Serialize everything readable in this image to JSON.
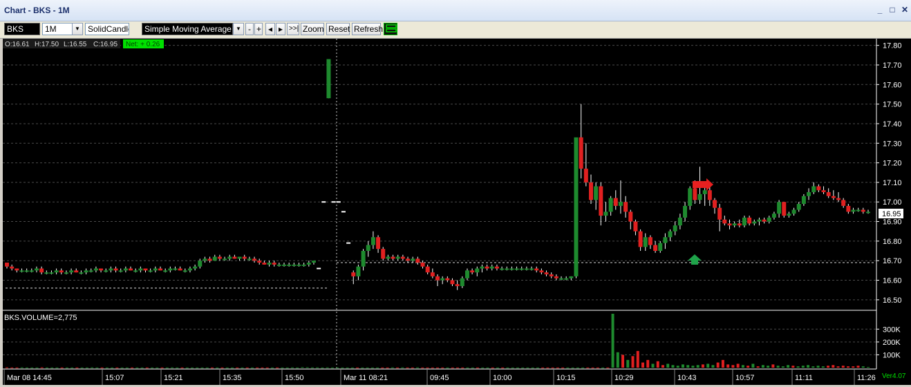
{
  "window": {
    "title": "Chart - BKS - 1M",
    "minimize": "_",
    "restore": "□",
    "close": "✕"
  },
  "toolbar": {
    "symbol": "BKS",
    "interval": "1M",
    "chart_style": "SolidCandle",
    "indicator": "Simple Moving Average",
    "minus": "-",
    "plus": "+",
    "prev": "◂",
    "next": "▸",
    "end": ">>|",
    "zoom": "Zoom",
    "reset": "Reset",
    "refresh": "Refresh"
  },
  "ohlc": {
    "open": "O:16.61",
    "high": "H:17.50",
    "low": "L:16.55",
    "close": "C:16.95",
    "net": "Net: + 0.26"
  },
  "volume_label": "BKS.VOLUME=2,775",
  "price_label": "16.95",
  "version": "Ver4.07",
  "colors": {
    "up": "#1e8a2e",
    "down": "#e02020",
    "grid": "#4a4a4a",
    "net_bg": "#00e000"
  },
  "chart_data": {
    "type": "candlestick",
    "y_ticks": [
      "17.80",
      "17.70",
      "17.60",
      "17.50",
      "17.40",
      "17.30",
      "17.20",
      "17.10",
      "17.00",
      "16.90",
      "16.80",
      "16.70",
      "16.60",
      "16.50"
    ],
    "ylim": [
      16.45,
      17.82
    ],
    "vol_ticks": [
      "300K",
      "200K",
      "100K"
    ],
    "x_ticks": [
      "Mar 08 14:45",
      "15:07",
      "15:21",
      "15:35",
      "15:50",
      "Mar 11 08:21",
      "09:45",
      "10:00",
      "10:15",
      "10:29",
      "10:43",
      "10:57",
      "11:11",
      "11:26"
    ],
    "prev_close": 16.69,
    "candles": [
      [
        16.69,
        16.69,
        16.66,
        16.67
      ],
      [
        16.67,
        16.68,
        16.65,
        16.66
      ],
      [
        16.66,
        16.66,
        16.64,
        16.65
      ],
      [
        16.65,
        16.66,
        16.64,
        16.65
      ],
      [
        16.65,
        16.66,
        16.64,
        16.65
      ],
      [
        16.65,
        16.66,
        16.64,
        16.65
      ],
      [
        16.65,
        16.67,
        16.64,
        16.66
      ],
      [
        16.66,
        16.67,
        16.63,
        16.64
      ],
      [
        16.64,
        16.65,
        16.63,
        16.64
      ],
      [
        16.64,
        16.65,
        16.63,
        16.64
      ],
      [
        16.64,
        16.66,
        16.63,
        16.65
      ],
      [
        16.65,
        16.66,
        16.63,
        16.64
      ],
      [
        16.64,
        16.65,
        16.63,
        16.64
      ],
      [
        16.64,
        16.66,
        16.63,
        16.65
      ],
      [
        16.65,
        16.66,
        16.64,
        16.64
      ],
      [
        16.64,
        16.65,
        16.63,
        16.64
      ],
      [
        16.64,
        16.66,
        16.63,
        16.65
      ],
      [
        16.65,
        16.66,
        16.64,
        16.65
      ],
      [
        16.65,
        16.67,
        16.64,
        16.66
      ],
      [
        16.66,
        16.66,
        16.64,
        16.65
      ],
      [
        16.65,
        16.66,
        16.64,
        16.65
      ],
      [
        16.65,
        16.67,
        16.64,
        16.66
      ],
      [
        16.66,
        16.67,
        16.64,
        16.65
      ],
      [
        16.65,
        16.66,
        16.64,
        16.65
      ],
      [
        16.65,
        16.67,
        16.64,
        16.66
      ],
      [
        16.66,
        16.67,
        16.65,
        16.65
      ],
      [
        16.65,
        16.66,
        16.64,
        16.65
      ],
      [
        16.65,
        16.67,
        16.64,
        16.66
      ],
      [
        16.66,
        16.66,
        16.64,
        16.65
      ],
      [
        16.65,
        16.66,
        16.64,
        16.65
      ],
      [
        16.65,
        16.67,
        16.64,
        16.66
      ],
      [
        16.66,
        16.67,
        16.65,
        16.65
      ],
      [
        16.65,
        16.66,
        16.64,
        16.65
      ],
      [
        16.65,
        16.67,
        16.64,
        16.66
      ],
      [
        16.66,
        16.67,
        16.65,
        16.66
      ],
      [
        16.66,
        16.67,
        16.65,
        16.65
      ],
      [
        16.65,
        16.66,
        16.64,
        16.65
      ],
      [
        16.65,
        16.67,
        16.64,
        16.66
      ],
      [
        16.66,
        16.68,
        16.65,
        16.67
      ],
      [
        16.67,
        16.71,
        16.66,
        16.7
      ],
      [
        16.7,
        16.72,
        16.69,
        16.71
      ],
      [
        16.71,
        16.72,
        16.69,
        16.7
      ],
      [
        16.7,
        16.73,
        16.7,
        16.72
      ],
      [
        16.72,
        16.73,
        16.7,
        16.71
      ],
      [
        16.71,
        16.72,
        16.7,
        16.71
      ],
      [
        16.71,
        16.73,
        16.7,
        16.72
      ],
      [
        16.72,
        16.73,
        16.71,
        16.71
      ],
      [
        16.71,
        16.72,
        16.7,
        16.72
      ],
      [
        16.72,
        16.73,
        16.7,
        16.71
      ],
      [
        16.71,
        16.72,
        16.7,
        16.71
      ],
      [
        16.71,
        16.72,
        16.69,
        16.7
      ],
      [
        16.7,
        16.71,
        16.68,
        16.69
      ],
      [
        16.69,
        16.7,
        16.68,
        16.68
      ],
      [
        16.68,
        16.7,
        16.67,
        16.69
      ],
      [
        16.69,
        16.7,
        16.67,
        16.68
      ],
      [
        16.68,
        16.69,
        16.67,
        16.68
      ],
      [
        16.68,
        16.69,
        16.67,
        16.68
      ],
      [
        16.68,
        16.69,
        16.67,
        16.68
      ],
      [
        16.68,
        16.69,
        16.67,
        16.68
      ],
      [
        16.68,
        16.69,
        16.67,
        16.68
      ],
      [
        16.68,
        16.69,
        16.67,
        16.68
      ],
      [
        16.68,
        16.7,
        16.67,
        16.69
      ],
      [
        16.69,
        16.7,
        16.68,
        16.7
      ],
      [
        16.66,
        16.66,
        16.66,
        16.66
      ],
      [
        17.0,
        17.0,
        17.0,
        17.0
      ],
      [
        17.53,
        17.73,
        17.53,
        17.73
      ],
      [
        17.0,
        17.0,
        17.0,
        17.0
      ],
      [
        17.0,
        17.0,
        17.0,
        17.0
      ],
      [
        16.95,
        16.95,
        16.95,
        16.95
      ],
      [
        16.79,
        16.79,
        16.79,
        16.79
      ],
      [
        16.64,
        16.65,
        16.58,
        16.62
      ],
      [
        16.62,
        16.68,
        16.6,
        16.67
      ],
      [
        16.67,
        16.76,
        16.65,
        16.75
      ],
      [
        16.75,
        16.8,
        16.72,
        16.78
      ],
      [
        16.78,
        16.85,
        16.76,
        16.82
      ],
      [
        16.82,
        16.83,
        16.74,
        16.76
      ],
      [
        16.76,
        16.77,
        16.7,
        16.71
      ],
      [
        16.71,
        16.73,
        16.7,
        16.72
      ],
      [
        16.72,
        16.73,
        16.7,
        16.71
      ],
      [
        16.71,
        16.73,
        16.7,
        16.72
      ],
      [
        16.72,
        16.73,
        16.7,
        16.71
      ],
      [
        16.71,
        16.72,
        16.69,
        16.7
      ],
      [
        16.7,
        16.72,
        16.69,
        16.71
      ],
      [
        16.71,
        16.72,
        16.68,
        16.69
      ],
      [
        16.69,
        16.7,
        16.66,
        16.67
      ],
      [
        16.67,
        16.68,
        16.63,
        16.64
      ],
      [
        16.64,
        16.66,
        16.61,
        16.62
      ],
      [
        16.62,
        16.63,
        16.57,
        16.6
      ],
      [
        16.6,
        16.62,
        16.58,
        16.61
      ],
      [
        16.61,
        16.62,
        16.59,
        16.6
      ],
      [
        16.6,
        16.61,
        16.57,
        16.58
      ],
      [
        16.58,
        16.6,
        16.55,
        16.57
      ],
      [
        16.57,
        16.62,
        16.56,
        16.61
      ],
      [
        16.61,
        16.66,
        16.6,
        16.65
      ],
      [
        16.65,
        16.66,
        16.63,
        16.64
      ],
      [
        16.64,
        16.67,
        16.62,
        16.66
      ],
      [
        16.66,
        16.68,
        16.64,
        16.67
      ],
      [
        16.67,
        16.68,
        16.65,
        16.66
      ],
      [
        16.66,
        16.68,
        16.65,
        16.67
      ],
      [
        16.67,
        16.68,
        16.65,
        16.66
      ],
      [
        16.66,
        16.67,
        16.65,
        16.66
      ],
      [
        16.66,
        16.67,
        16.65,
        16.66
      ],
      [
        16.66,
        16.67,
        16.65,
        16.66
      ],
      [
        16.66,
        16.67,
        16.65,
        16.66
      ],
      [
        16.66,
        16.67,
        16.65,
        16.66
      ],
      [
        16.66,
        16.67,
        16.65,
        16.66
      ],
      [
        16.66,
        16.67,
        16.65,
        16.66
      ],
      [
        16.66,
        16.67,
        16.64,
        16.65
      ],
      [
        16.65,
        16.66,
        16.63,
        16.64
      ],
      [
        16.64,
        16.65,
        16.62,
        16.63
      ],
      [
        16.63,
        16.64,
        16.61,
        16.62
      ],
      [
        16.62,
        16.63,
        16.6,
        16.61
      ],
      [
        16.61,
        16.62,
        16.6,
        16.61
      ],
      [
        16.61,
        16.62,
        16.6,
        16.61
      ],
      [
        16.61,
        16.62,
        16.6,
        16.62
      ],
      [
        16.62,
        17.32,
        16.61,
        17.33
      ],
      [
        17.33,
        17.5,
        17.12,
        17.17
      ],
      [
        17.17,
        17.3,
        17.08,
        17.1
      ],
      [
        17.1,
        17.14,
        16.99,
        17.01
      ],
      [
        17.01,
        17.1,
        16.96,
        17.08
      ],
      [
        17.08,
        17.1,
        16.88,
        16.93
      ],
      [
        16.93,
        17.0,
        16.9,
        16.95
      ],
      [
        16.95,
        17.03,
        16.93,
        17.02
      ],
      [
        17.02,
        17.06,
        16.96,
        16.98
      ],
      [
        16.98,
        17.11,
        16.94,
        17.0
      ],
      [
        17.0,
        17.03,
        16.92,
        16.95
      ],
      [
        16.95,
        16.96,
        16.86,
        16.9
      ],
      [
        16.9,
        16.91,
        16.83,
        16.85
      ],
      [
        16.85,
        16.86,
        16.75,
        16.77
      ],
      [
        16.77,
        16.84,
        16.75,
        16.82
      ],
      [
        16.82,
        16.83,
        16.76,
        16.78
      ],
      [
        16.78,
        16.8,
        16.74,
        16.75
      ],
      [
        16.75,
        16.8,
        16.74,
        16.79
      ],
      [
        16.79,
        16.84,
        16.76,
        16.82
      ],
      [
        16.82,
        16.86,
        16.8,
        16.85
      ],
      [
        16.85,
        16.9,
        16.83,
        16.88
      ],
      [
        16.88,
        16.94,
        16.86,
        16.92
      ],
      [
        16.92,
        17.0,
        16.9,
        16.98
      ],
      [
        16.98,
        17.08,
        16.96,
        17.07
      ],
      [
        17.07,
        17.11,
        16.99,
        17.01
      ],
      [
        17.01,
        17.18,
        16.99,
        17.04
      ],
      [
        17.04,
        17.08,
        16.98,
        17.06
      ],
      [
        17.06,
        17.08,
        16.98,
        17.01
      ],
      [
        17.01,
        17.02,
        16.94,
        16.97
      ],
      [
        16.97,
        16.99,
        16.85,
        16.91
      ],
      [
        16.91,
        16.93,
        16.88,
        16.89
      ],
      [
        16.89,
        16.91,
        16.86,
        16.88
      ],
      [
        16.88,
        16.9,
        16.87,
        16.89
      ],
      [
        16.89,
        16.91,
        16.87,
        16.88
      ],
      [
        16.88,
        16.93,
        16.87,
        16.92
      ],
      [
        16.92,
        16.93,
        16.88,
        16.89
      ],
      [
        16.89,
        16.91,
        16.88,
        16.9
      ],
      [
        16.9,
        16.92,
        16.88,
        16.91
      ],
      [
        16.91,
        16.92,
        16.89,
        16.9
      ],
      [
        16.9,
        16.93,
        16.89,
        16.92
      ],
      [
        16.92,
        16.95,
        16.91,
        16.94
      ],
      [
        16.94,
        17.01,
        16.92,
        17.0
      ],
      [
        17.0,
        17.0,
        16.92,
        16.93
      ],
      [
        16.93,
        16.95,
        16.92,
        16.94
      ],
      [
        16.94,
        16.97,
        16.93,
        16.96
      ],
      [
        16.96,
        17.0,
        16.95,
        16.99
      ],
      [
        16.99,
        17.04,
        16.98,
        17.03
      ],
      [
        17.03,
        17.07,
        17.01,
        17.05
      ],
      [
        17.05,
        17.1,
        17.04,
        17.08
      ],
      [
        17.08,
        17.09,
        17.05,
        17.06
      ],
      [
        17.06,
        17.08,
        17.04,
        17.05
      ],
      [
        17.05,
        17.07,
        17.02,
        17.03
      ],
      [
        17.03,
        17.06,
        17.01,
        17.02
      ],
      [
        17.02,
        17.05,
        17.0,
        17.01
      ],
      [
        17.01,
        17.02,
        16.97,
        16.98
      ],
      [
        16.98,
        16.99,
        16.94,
        16.95
      ],
      [
        16.95,
        16.97,
        16.94,
        16.96
      ],
      [
        16.96,
        16.97,
        16.95,
        16.96
      ],
      [
        16.96,
        16.97,
        16.94,
        16.95
      ],
      [
        16.95,
        16.96,
        16.94,
        16.95
      ]
    ],
    "volume": [
      2,
      1,
      1,
      2,
      1,
      1,
      1,
      2,
      1,
      1,
      1,
      1,
      1,
      1,
      1,
      1,
      1,
      2,
      1,
      1,
      1,
      1,
      1,
      1,
      1,
      1,
      1,
      1,
      1,
      1,
      1,
      1,
      1,
      2,
      1,
      1,
      1,
      1,
      1,
      1,
      1,
      1,
      1,
      1,
      1,
      1,
      1,
      1,
      1,
      1,
      1,
      1,
      1,
      1,
      1,
      1,
      1,
      2,
      1,
      4,
      3,
      2,
      2,
      1,
      2,
      1,
      1,
      1,
      1,
      1,
      1,
      1,
      1,
      1,
      1,
      1,
      1,
      2,
      1,
      2,
      1,
      1,
      2,
      1,
      1,
      1,
      1,
      1,
      1,
      1,
      1,
      1,
      1,
      1,
      1,
      1,
      1,
      1,
      1,
      1,
      1,
      1,
      1,
      1,
      1,
      1,
      1,
      1,
      1,
      1,
      1,
      1,
      1,
      1,
      1,
      1,
      1,
      1,
      1,
      1,
      1,
      420,
      120,
      100,
      60,
      90,
      130,
      40,
      60,
      30,
      50,
      20,
      30,
      20,
      15,
      25,
      20,
      15,
      20,
      25,
      30,
      20,
      40,
      60,
      25,
      20,
      30,
      20,
      15,
      30,
      10,
      20,
      15,
      25,
      15,
      10,
      20,
      15,
      10,
      15,
      20,
      10,
      15,
      10,
      15,
      20,
      10,
      15,
      10,
      10,
      15,
      10,
      5
    ]
  }
}
